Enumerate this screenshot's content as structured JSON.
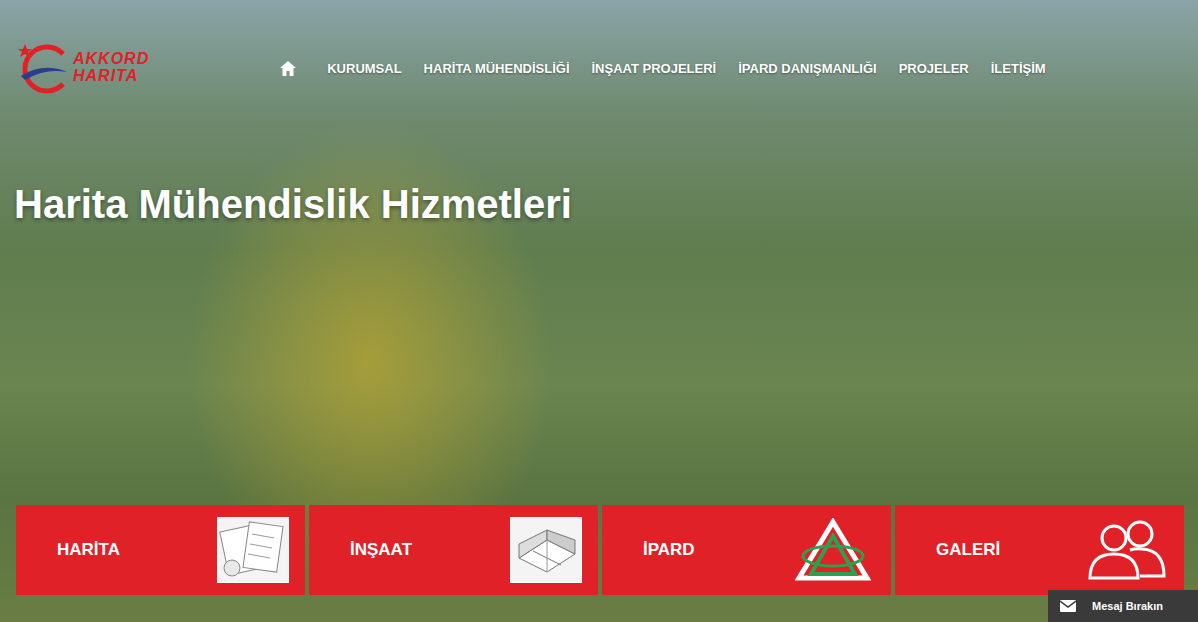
{
  "logo": {
    "line1": "AKKORD",
    "line2": "HARITA"
  },
  "nav": {
    "items": [
      "KURUMSAL",
      "HARİTA MÜHENDİSLİĞİ",
      "İNŞAAT PROJELERİ",
      "İPARD DANIŞMANLIĞI",
      "PROJELER",
      "İLETİŞİM"
    ]
  },
  "hero": {
    "title": "Harita Mühendislik Hizmetleri"
  },
  "tiles": [
    {
      "label": "HARİTA",
      "kind": "blueprint"
    },
    {
      "label": "İNŞAAT",
      "kind": "plan"
    },
    {
      "label": "İPARD",
      "kind": "emblem"
    },
    {
      "label": "GALERİ",
      "kind": "people"
    }
  ],
  "message_button": {
    "label": "Mesaj Bırakın"
  }
}
